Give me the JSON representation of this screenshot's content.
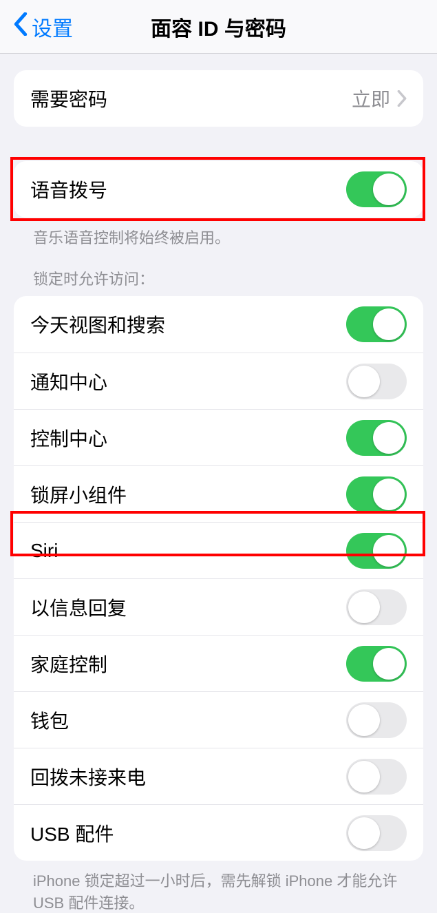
{
  "nav": {
    "back_label": "设置",
    "title": "面容 ID 与密码"
  },
  "require_passcode": {
    "label": "需要密码",
    "value": "立即"
  },
  "voice_dial": {
    "label": "语音拨号",
    "on": true,
    "footnote": "音乐语音控制将始终被启用。"
  },
  "lock_header": "锁定时允许访问：",
  "lock_items": [
    {
      "label": "今天视图和搜索",
      "on": true
    },
    {
      "label": "通知中心",
      "on": false
    },
    {
      "label": "控制中心",
      "on": true
    },
    {
      "label": "锁屏小组件",
      "on": true
    },
    {
      "label": "Siri",
      "on": true
    },
    {
      "label": "以信息回复",
      "on": false
    },
    {
      "label": "家庭控制",
      "on": true
    },
    {
      "label": "钱包",
      "on": false
    },
    {
      "label": "回拨未接来电",
      "on": false
    },
    {
      "label": "USB 配件",
      "on": false
    }
  ],
  "bottom_note": "iPhone 锁定超过一小时后，需先解锁 iPhone 才能允许 USB 配件连接。"
}
